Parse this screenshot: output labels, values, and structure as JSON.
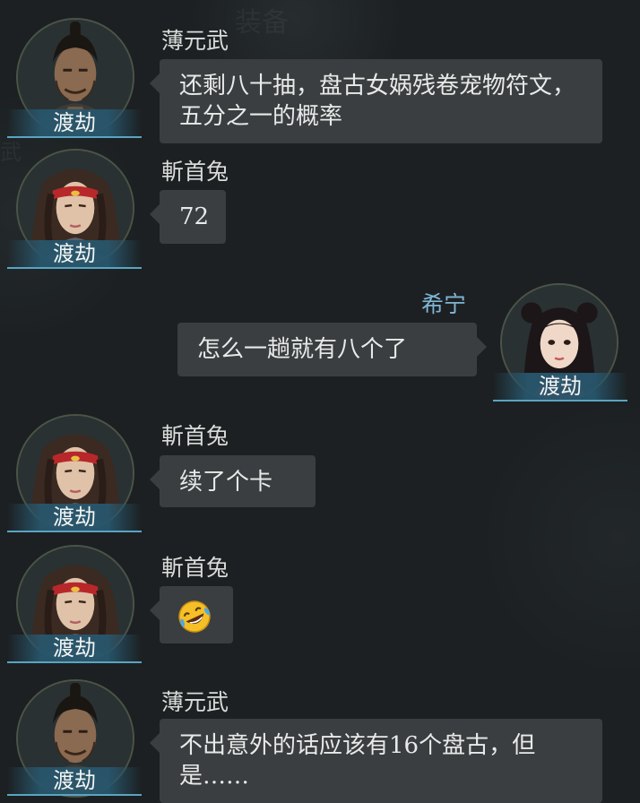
{
  "background": {
    "watermarks": [
      "装备",
      "武"
    ]
  },
  "messages": [
    {
      "sender": "薄元武",
      "rank": "渡劫",
      "avatar": "topknot-warrior-avatar",
      "side": "left",
      "text": "还剩八十抽，盘古女娲残卷宠物符文，五分之一的概率"
    },
    {
      "sender": "斬首兔",
      "rank": "渡劫",
      "avatar": "headband-swordsman-avatar",
      "side": "left",
      "text": "72"
    },
    {
      "sender": "希宁",
      "rank": "渡劫",
      "avatar": "female-hero-avatar",
      "side": "right",
      "text": "怎么一趟就有八个了"
    },
    {
      "sender": "斬首兔",
      "rank": "渡劫",
      "avatar": "headband-swordsman-avatar",
      "side": "left",
      "text": "续了个卡"
    },
    {
      "sender": "斬首兔",
      "rank": "渡劫",
      "avatar": "headband-swordsman-avatar",
      "side": "left",
      "emoji": "laughing-tears-emoji"
    },
    {
      "sender": "薄元武",
      "rank": "渡劫",
      "avatar": "topknot-warrior-avatar",
      "side": "left",
      "text": "不出意外的话应该有16个盘古，但是……"
    }
  ],
  "colors": {
    "background": "#1c2022",
    "bubble": "#3a3e40",
    "self_name": "#7fb6d6",
    "rank_tag": "#285668",
    "rank_tag_line": "#5aa4c2",
    "avatar_ring": "#4b5447"
  }
}
